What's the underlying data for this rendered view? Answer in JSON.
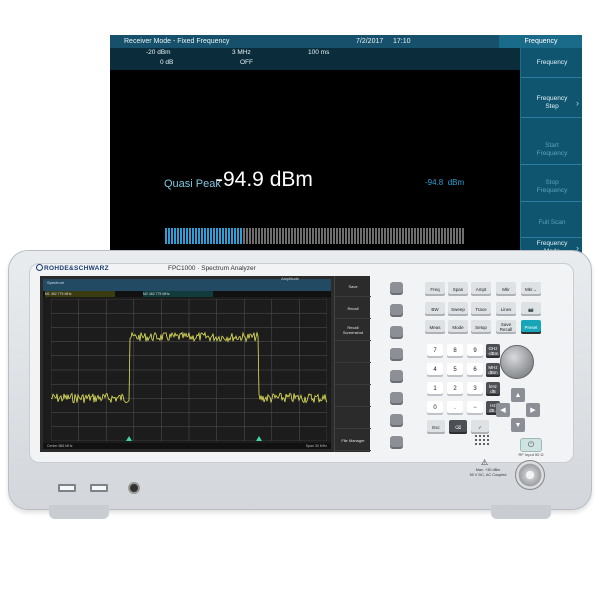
{
  "receiver": {
    "header": {
      "mode": "Receiver Mode - Fixed Frequency",
      "date": "7/2/2017",
      "time": "17:10"
    },
    "params": {
      "ref_value": "-20 dBm",
      "att_value": "0 dB",
      "rbw_value": "3 MHz",
      "pa_value": "OFF",
      "mt_value": "100 ms"
    },
    "reading": {
      "detector": "Quasi Peak",
      "value": "-94.9 dBm",
      "small_value": "-94.8",
      "small_unit": "dBm",
      "level_min": -120,
      "level_max": -20,
      "level": -94.9
    },
    "scale_ticks": [
      "-120.0",
      "-110.0",
      "-100.0",
      "-90.0",
      "-80.0",
      "-70.0",
      "-60.0",
      "-50.0",
      "-40.0",
      "-30.0",
      "-20.0"
    ],
    "softkeys": {
      "title": "Frequency",
      "items": [
        {
          "label": "Frequency",
          "active": true
        },
        {
          "label": "Frequency\nStep",
          "active": true,
          "arrow": true
        },
        {
          "label": "Start\nFrequency",
          "active": false
        },
        {
          "label": "Stop\nFrequency",
          "active": false
        },
        {
          "label": "Full Scan",
          "active": false
        },
        {
          "label": "Frequency\nMode",
          "active": true,
          "arrow": true
        },
        {
          "label": "",
          "active": true
        }
      ]
    },
    "colors": {
      "header": "#17506a",
      "bar_active": "#2e9fd6",
      "bar_inactive": "#6e6e6e"
    }
  },
  "instrument": {
    "brand": "ROHDE&SCHWARZ",
    "model": "FPC1000 · Spectrum Analyzer",
    "lcd": {
      "title": "Spectrum",
      "amplitude": "Amplitude",
      "marker1": "M1 462 775 MHz",
      "marker2": "M2 462 775 MHz",
      "bottom_left": "Center 686 MHz",
      "bottom_right": "Span 30 MHz",
      "softkeys": [
        "Save",
        "Recall",
        "Recall\nScreenshot",
        "",
        "",
        "",
        "",
        "File Manager"
      ]
    },
    "keys": {
      "row1": [
        "Freq",
        "Span",
        "Ampt",
        "Mkr",
        "Mkr→"
      ],
      "row2": [
        "BW",
        "Sweep",
        "Trace",
        "Lines",
        "📷"
      ],
      "row3": [
        "Meas",
        "Mode",
        "Setup",
        "Save\nRecall",
        "Preset"
      ],
      "numbers": [
        "7",
        "8",
        "9",
        "4",
        "5",
        "6",
        "1",
        "2",
        "3",
        "0",
        ".",
        "−"
      ],
      "units": [
        "GHz\n-dBm",
        "MHz\ndBm",
        "kHz\ndB",
        "Hz\ndB.."
      ],
      "bottom": [
        "Esc",
        "⌫",
        "✓"
      ]
    },
    "rf_label": "RF Input 50 Ω",
    "warning": "Max. +30 dBm\n50 V DC, AC Coupled"
  }
}
